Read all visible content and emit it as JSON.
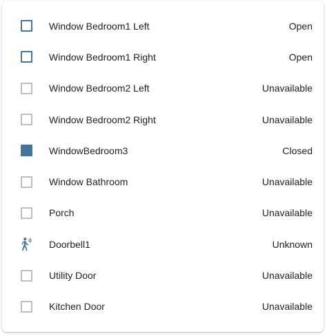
{
  "entities": [
    {
      "name": "Window Bedroom1 Left",
      "state": "Open",
      "icon": "window-open-icon"
    },
    {
      "name": "Window Bedroom1 Right",
      "state": "Open",
      "icon": "window-open-icon"
    },
    {
      "name": "Window Bedroom2 Left",
      "state": "Unavailable",
      "icon": "window-unavailable-icon"
    },
    {
      "name": "Window Bedroom2 Right",
      "state": "Unavailable",
      "icon": "window-unavailable-icon"
    },
    {
      "name": "WindowBedroom3",
      "state": "Closed",
      "icon": "window-closed-icon"
    },
    {
      "name": "Window Bathroom",
      "state": "Unavailable",
      "icon": "window-unavailable-icon"
    },
    {
      "name": "Porch",
      "state": "Unavailable",
      "icon": "window-unavailable-icon"
    },
    {
      "name": "Doorbell1",
      "state": "Unknown",
      "icon": "motion-sensor-icon"
    },
    {
      "name": "Utility Door",
      "state": "Unavailable",
      "icon": "window-unavailable-icon"
    },
    {
      "name": "Kitchen Door",
      "state": "Unavailable",
      "icon": "window-unavailable-icon"
    }
  ],
  "colors": {
    "active_icon": "#44739e",
    "inactive_icon": "#bdbdbd",
    "text": "#212121"
  }
}
